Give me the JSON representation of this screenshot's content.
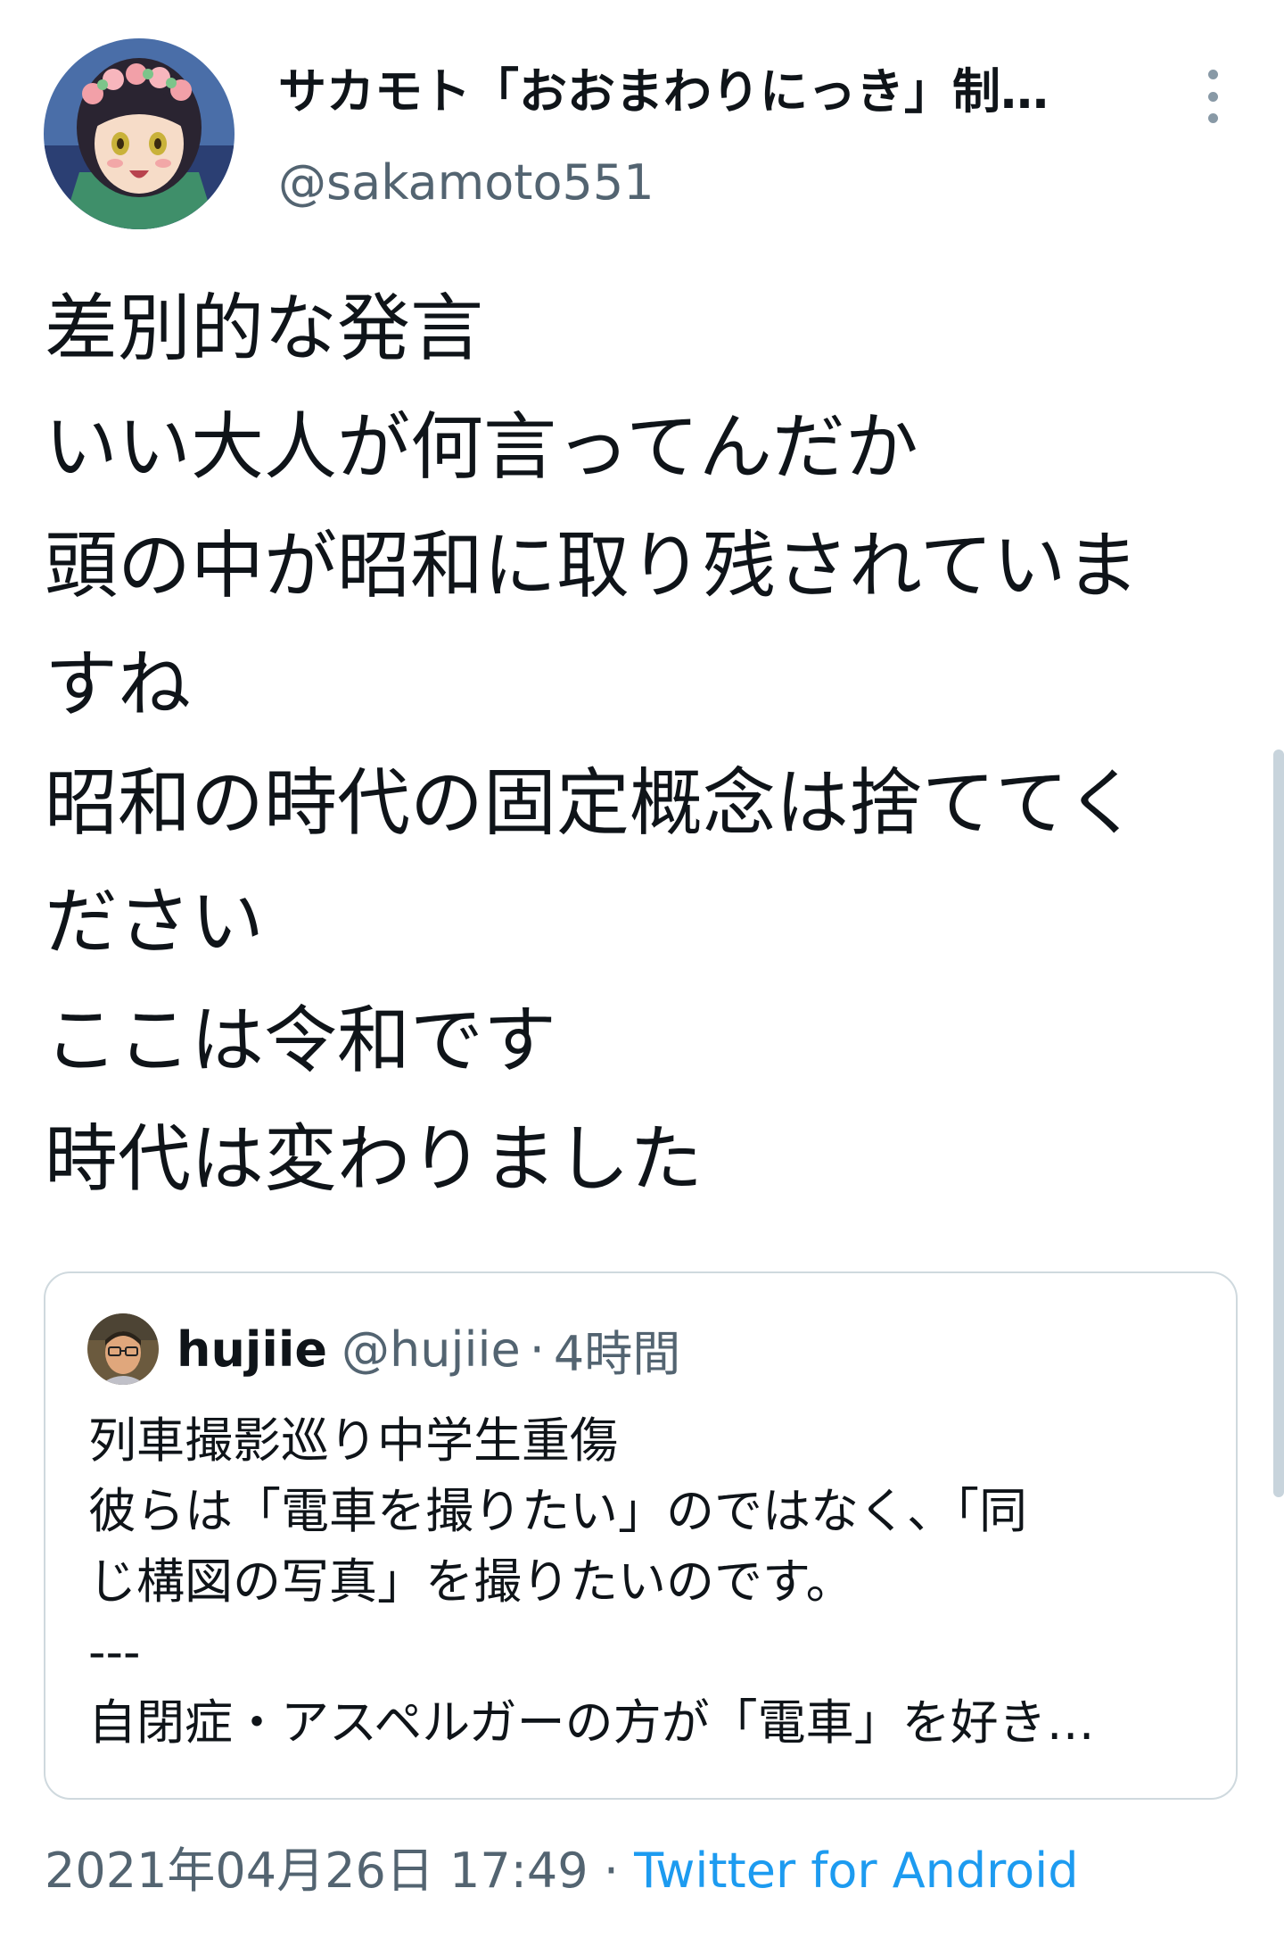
{
  "author": {
    "display_name": "サカモト「おおまわりにっき」制…",
    "handle": "@sakamoto551",
    "avatar_icon": "anime-girl-flower-crown-avatar"
  },
  "menu": {
    "icon": "more-vertical-icon"
  },
  "tweet": {
    "lines": [
      "差別的な発言",
      "いい大人が何言ってんだか",
      "頭の中が昭和に取り残されていま",
      "すね",
      "昭和の時代の固定概念は捨ててく",
      "ださい",
      "ここは令和です",
      "時代は変わりました"
    ]
  },
  "quote": {
    "name": "hujiie",
    "handle": "@hujiie",
    "separator": "·",
    "time": "4時間",
    "avatar_icon": "man-with-glasses-avatar",
    "lines": [
      "列車撮影巡り中学生重傷",
      "彼らは「電車を撮りたい」のではなく、「同",
      "じ構図の写真」を撮りたいのです。",
      "---",
      "自閉症・アスペルガーの方が「電車」を好き…"
    ]
  },
  "meta": {
    "timestamp": "2021年04月26日 17:49",
    "separator": "·",
    "source": "Twitter for Android"
  },
  "colors": {
    "text": "#0f1419",
    "secondary": "#536471",
    "link": "#1d9bf0",
    "border": "#cfd9de",
    "scrollbar": "#c8d4dc"
  }
}
